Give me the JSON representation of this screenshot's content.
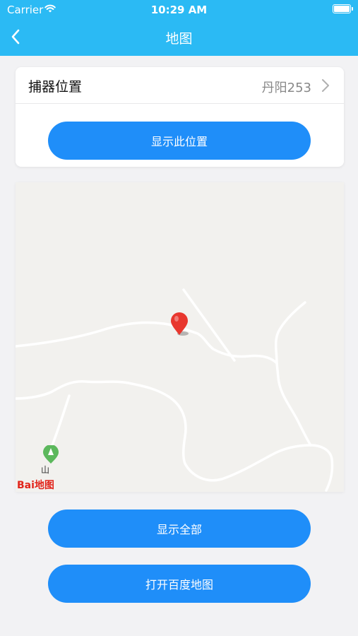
{
  "status_bar": {
    "carrier": "Carrier",
    "time": "10:29 AM"
  },
  "nav": {
    "title": "地图"
  },
  "location_card": {
    "label": "捕器位置",
    "value": "丹阳253",
    "show_location_button": "显示此位置"
  },
  "map": {
    "logo_text": "Bai地图",
    "poi_label": "山"
  },
  "actions": {
    "show_all": "显示全部",
    "open_baidu_map": "打开百度地图"
  },
  "colors": {
    "header": "#2bbaf4",
    "button": "#1f8ef9",
    "marker": "#e8372e",
    "map_bg": "#f2f1ee"
  }
}
